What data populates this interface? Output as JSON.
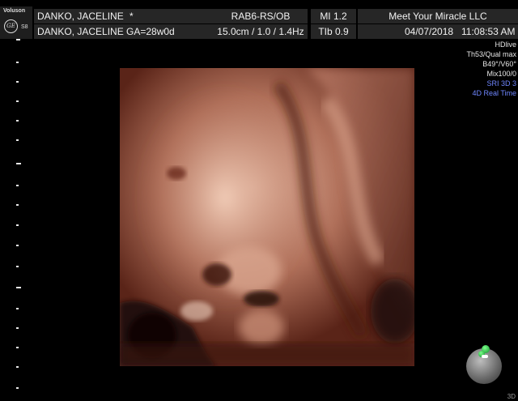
{
  "header": {
    "logo": {
      "brand": "Voluson",
      "model": "S8",
      "mark": "GE"
    },
    "patient_name": "DANKO, JACELINE",
    "patient_flag": "*",
    "patient_ga_line": "DANKO, JACELINE  GA=28w0d",
    "probe": "RAB6-RS/OB",
    "mi": "MI  1.2",
    "clinic": "Meet Your Miracle LLC",
    "depth_settings": "15.0cm / 1.0 / 1.4Hz",
    "tib": "TIb  0.9",
    "date": "04/07/2018",
    "time": "11:08:53 AM"
  },
  "params": [
    {
      "text": "HDlive",
      "color": "#e6e6e6"
    },
    {
      "text": "Th53/Qual max",
      "color": "#e6e6e6"
    },
    {
      "text": "B49°/V60°",
      "color": "#e6e6e6"
    },
    {
      "text": "Mix100/0",
      "color": "#e6e6e6"
    },
    {
      "text": "SRI 3D 3",
      "color": "#6f86ff"
    },
    {
      "text": "4D Real Time",
      "color": "#6f86ff"
    }
  ],
  "corner_label": "3D",
  "colors": {
    "header_cell": "#262626",
    "param_white": "#e6e6e6",
    "param_blue": "#6f86ff",
    "render_dark": "#3a1810",
    "render_mid": "#9a5a48",
    "render_light": "#e8b6a0"
  }
}
